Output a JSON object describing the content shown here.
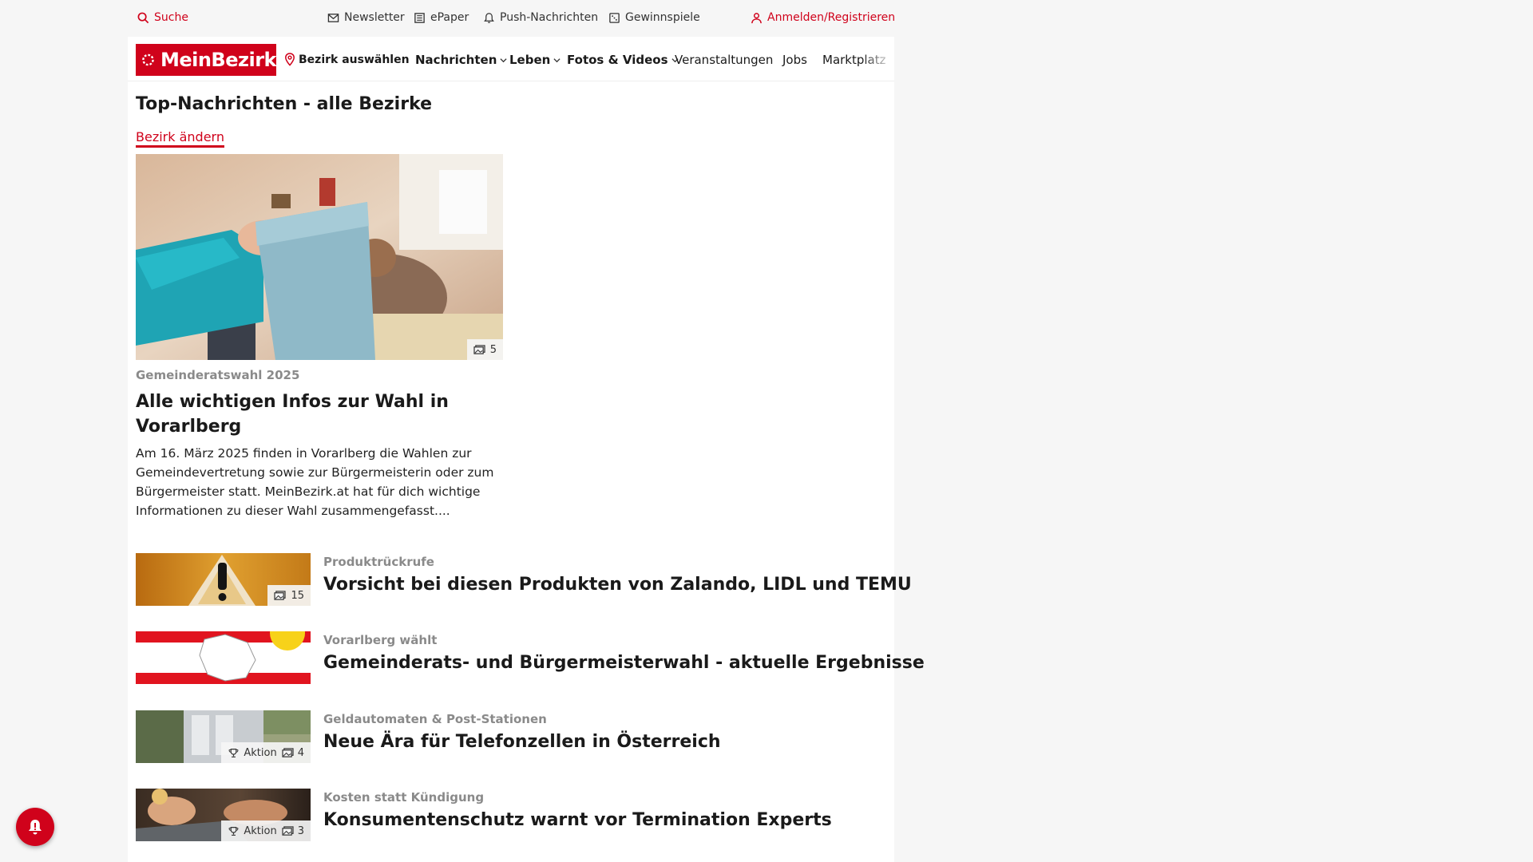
{
  "utility_bar": {
    "search": "Suche",
    "newsletter": "Newsletter",
    "epaper": "ePaper",
    "push": "Push-Nachrichten",
    "gewinnspiele": "Gewinnspiele",
    "login": "Anmelden/Registrieren"
  },
  "nav": {
    "logo": "MeinBezirk",
    "district_select": "Bezirk auswählen",
    "items": [
      "Nachrichten",
      "Leben",
      "Fotos & Videos",
      "Veranstaltungen",
      "Jobs",
      "Marktplatz"
    ]
  },
  "section": {
    "title": "Top-Nachrichten - alle Bezirke",
    "change_link": "Bezirk ändern"
  },
  "hero": {
    "image_count": "5",
    "category": "Gemeinderatswahl 2025",
    "title": "Alle wichtigen Infos zur Wahl in Vorarlberg",
    "teaser": "Am 16. März 2025 finden in Vorarlberg die Wahlen zur Gemeindevertretung sowie zur Bürgermeisterin oder zum Bürgermeister statt. MeinBezirk.at hat für dich wichtige Informationen zu dieser Wahl zusammengefasst...."
  },
  "articles": [
    {
      "category": "Produktrückrufe",
      "title": "Vorsicht bei diesen Produkten von Zalando, LIDL und TEMU",
      "image_count": "15",
      "aktion": ""
    },
    {
      "category": "Vorarlberg wählt",
      "title": "Gemeinderats- und Bürgermeisterwahl - aktuelle Ergebnisse",
      "image_count": "",
      "aktion": ""
    },
    {
      "category": "Geldautomaten & Post-Stationen",
      "title": "Neue Ära für Telefonzellen in Österreich",
      "image_count": "4",
      "aktion": "Aktion"
    },
    {
      "category": "Kosten statt Kündigung",
      "title": "Konsumentenschutz warnt vor Termination Experts",
      "image_count": "3",
      "aktion": "Aktion"
    }
  ],
  "colors": {
    "brand": "#d0021b",
    "muted": "#8a8a8a"
  },
  "icons": [
    "search-icon",
    "mail-icon",
    "newspaper-icon",
    "bell-icon",
    "gift-icon",
    "user-icon",
    "map-pin-icon",
    "chevron-down-icon",
    "gallery-icon",
    "trophy-icon"
  ]
}
